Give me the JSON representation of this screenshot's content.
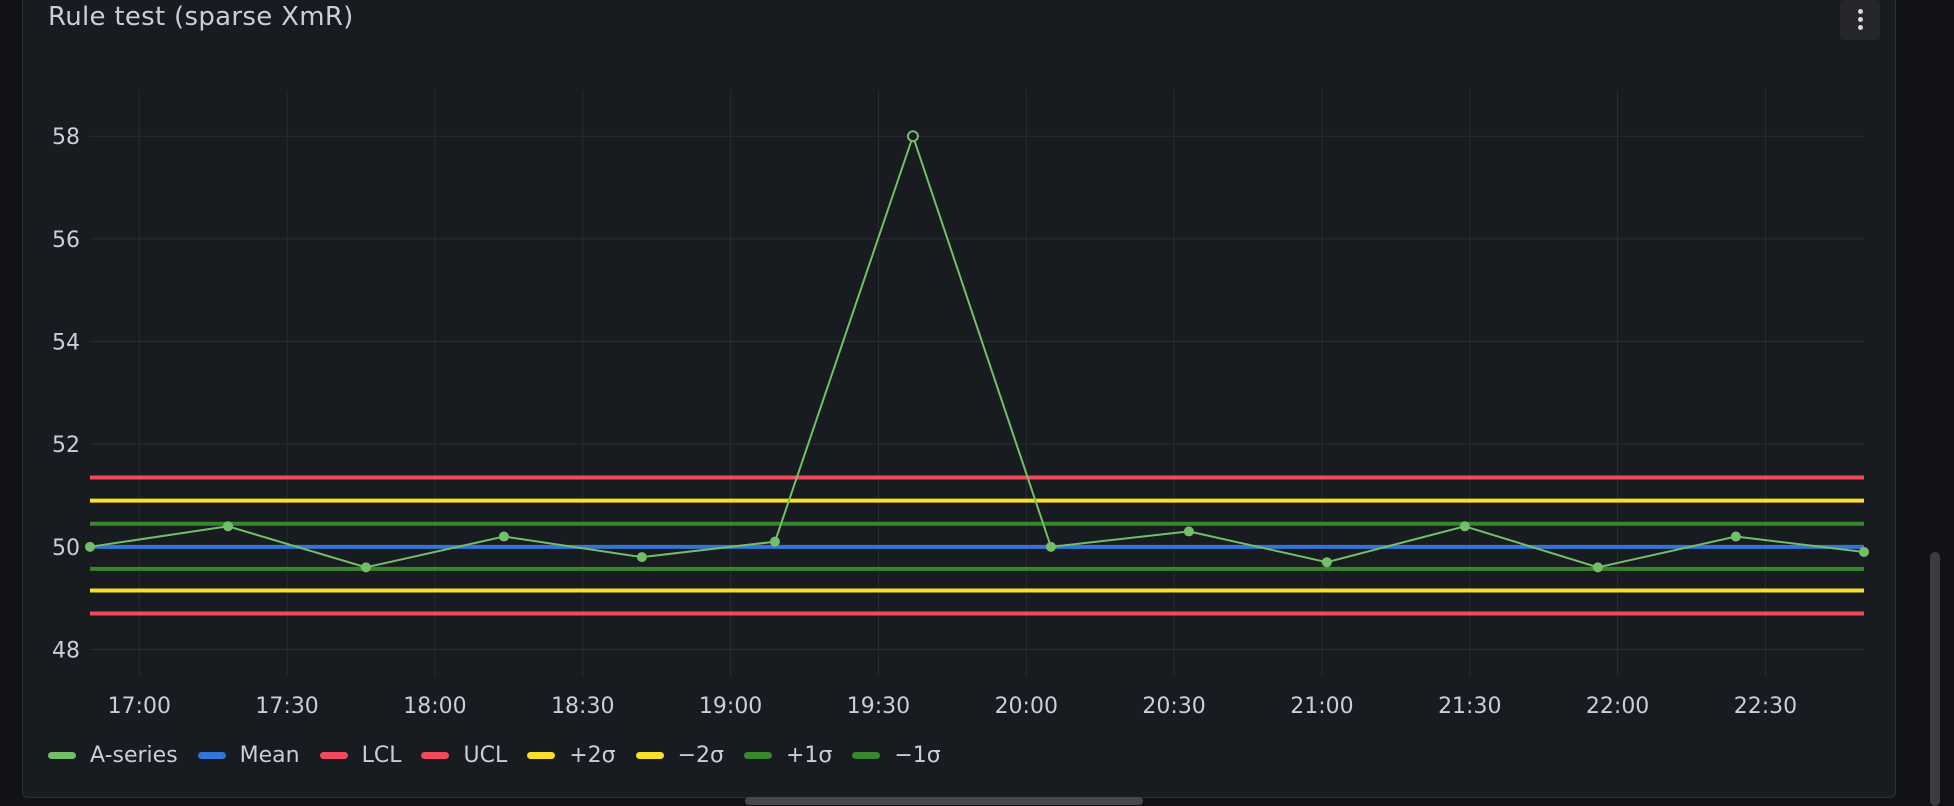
{
  "panel": {
    "title": "Rule test (sparse XmR)",
    "menu_icon": "kebab-vertical-icon"
  },
  "chart_data": {
    "type": "line",
    "title": "Rule test (sparse XmR)",
    "xlabel": "",
    "ylabel": "",
    "x_ticks": [
      "17:00",
      "17:30",
      "18:00",
      "18:30",
      "19:00",
      "19:30",
      "20:00",
      "20:30",
      "21:00",
      "21:30",
      "22:00",
      "22:30"
    ],
    "x_range": [
      "16:50",
      "22:50"
    ],
    "y_ticks": [
      48,
      50,
      52,
      54,
      56,
      58
    ],
    "ylim": [
      47.6,
      58.9
    ],
    "grid": true,
    "legend_position": "bottom-left",
    "series": [
      {
        "name": "A-series",
        "color": "#73bf69",
        "style": "line-with-points",
        "x": [
          "16:50",
          "17:18",
          "17:46",
          "18:14",
          "18:42",
          "19:09",
          "19:37",
          "20:05",
          "20:33",
          "21:01",
          "21:29",
          "21:56",
          "22:24",
          "22:50"
        ],
        "values": [
          50.0,
          50.4,
          49.6,
          50.2,
          49.8,
          50.1,
          58.0,
          50.0,
          50.3,
          49.7,
          50.4,
          49.6,
          50.2,
          49.9
        ]
      },
      {
        "name": "Mean",
        "color": "#3274d9",
        "style": "constant",
        "value": 50.0
      },
      {
        "name": "LCL",
        "color": "#f2495c",
        "style": "constant",
        "value": 48.7
      },
      {
        "name": "UCL",
        "color": "#f2495c",
        "style": "constant",
        "value": 51.35
      },
      {
        "name": "+2σ",
        "color": "#fade2a",
        "style": "constant",
        "value": 50.9
      },
      {
        "name": "−2σ",
        "color": "#fade2a",
        "style": "constant",
        "value": 49.15
      },
      {
        "name": "+1σ",
        "color": "#37872d",
        "style": "constant",
        "value": 50.45
      },
      {
        "name": "−1σ",
        "color": "#37872d",
        "style": "constant",
        "value": 49.57
      }
    ],
    "highlighted_point": {
      "series": "A-series",
      "x": "19:37",
      "value": 58.0,
      "marker": "hollow-circle"
    }
  },
  "colors": {
    "background": "#111217",
    "panel": "#181b1f",
    "grid": "#2a2d33",
    "text": "#ccccdc"
  }
}
